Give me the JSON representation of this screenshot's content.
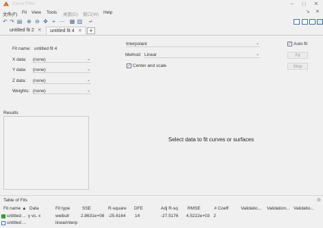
{
  "window": {
    "title": "Curve Fitter"
  },
  "menu": [
    "文件(F)",
    "Fit",
    "View",
    "Tools",
    "桌面(D)",
    "窗口(W)",
    "Help"
  ],
  "tabs": [
    {
      "label": "untitled fit 2"
    },
    {
      "label": "untitled fit 4"
    }
  ],
  "fit": {
    "name_label": "Fit name:",
    "name_value": "untitled fit 4",
    "x_label": "X data:",
    "x_value": "(none)",
    "y_label": "Y data:",
    "y_value": "(none)",
    "z_label": "Z data:",
    "z_value": "(none)",
    "w_label": "Weights:",
    "w_value": "(none)"
  },
  "method": {
    "type_value": "Interpolant",
    "method_label": "Method:",
    "method_value": "Linear",
    "center_scale_label": "Center and scale",
    "center_scale_checked": true
  },
  "actions": {
    "autofit_label": "Auto fit",
    "autofit_checked": true,
    "fit_label": "Fit",
    "stop_label": "Stop"
  },
  "results": {
    "heading": "Results"
  },
  "plot": {
    "message": "Select data to fit curves or surfaces"
  },
  "table": {
    "title": "Table of Fits",
    "headers": [
      "Fit name ▲",
      "Data",
      "Fit type",
      "SSE",
      "R-square",
      "DFE",
      "Adj R-sq",
      "RMSE",
      "# Coeff",
      "Validatio...",
      "Validation...",
      "Validatio..."
    ],
    "rows": [
      [
        "untitled ...",
        "y vs. x",
        "weibull",
        "2.8631e+08",
        "-25.6164",
        "14",
        "-27.5176",
        "4.5222e+03",
        "2",
        "",
        "",
        ""
      ],
      [
        "untitled ...",
        "",
        "linearinterp",
        "",
        "",
        "",
        "",
        "",
        "",
        "",
        "",
        ""
      ]
    ]
  },
  "colors": {
    "check": "#1c5bb4",
    "row_icon_green": "#3a9a3a",
    "row_icon_blue": "#3f6fb5"
  }
}
